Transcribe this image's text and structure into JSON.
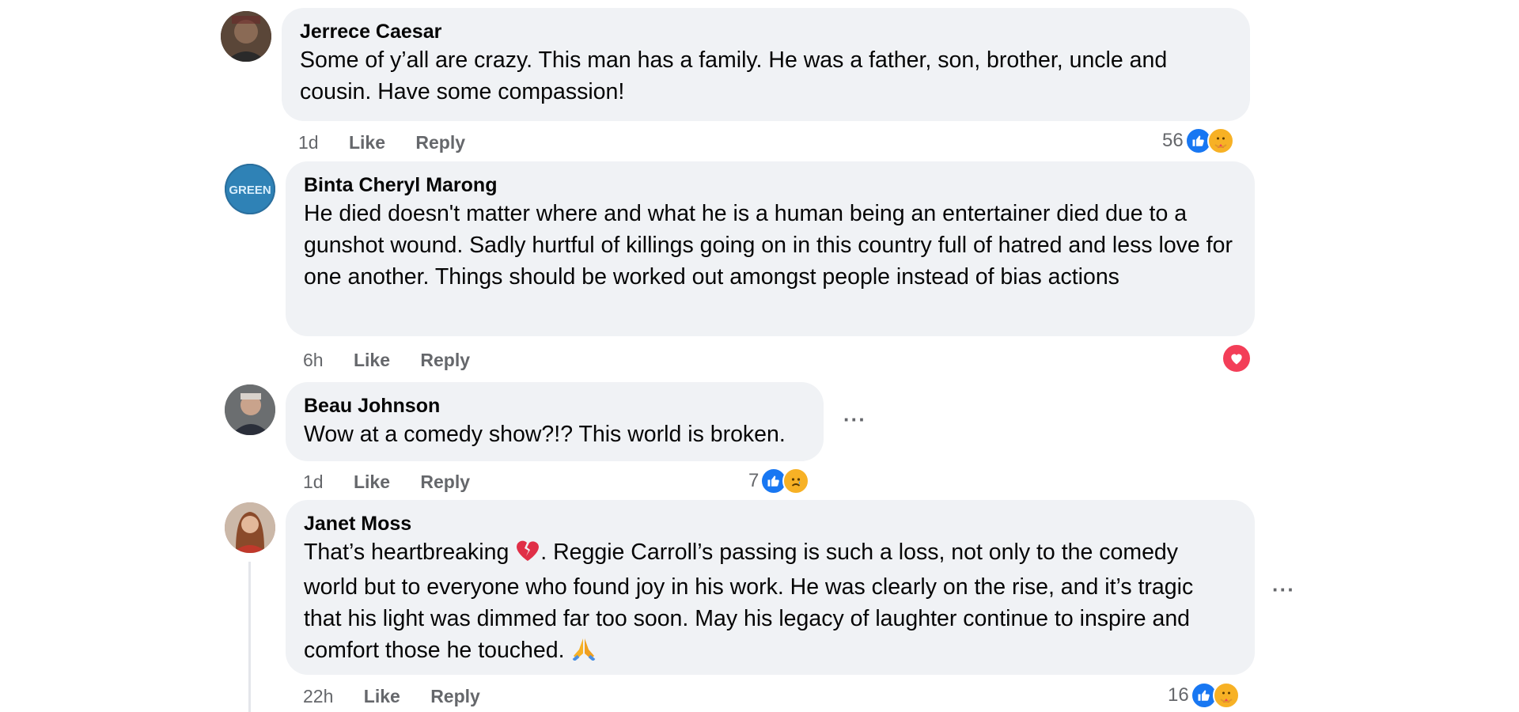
{
  "comments": [
    {
      "author": "Jerrece Caesar",
      "text": "Some of y’all are crazy. This man has a family. He was a father, son, brother, uncle and cousin. Have some compassion!",
      "time": "1d",
      "like_label": "Like",
      "reply_label": "Reply",
      "reaction_count": "56",
      "reactions": [
        "like-icon",
        "care-icon"
      ]
    },
    {
      "author": "Binta Cheryl Marong",
      "avatar_text": "GREEN",
      "text": "He died doesn't matter where and what he is a human being an entertainer died due to a gunshot wound. Sadly hurtful of killings going on in this country full of hatred and less love for one another. Things should be worked out amongst people instead of bias actions",
      "time": "6h",
      "like_label": "Like",
      "reply_label": "Reply",
      "reactions": [
        "love-icon"
      ]
    },
    {
      "author": "Beau Johnson",
      "text": "Wow at a comedy show?!? This world is broken.",
      "time": "1d",
      "like_label": "Like",
      "reply_label": "Reply",
      "reaction_count": "7",
      "reactions": [
        "like-icon",
        "sad-icon"
      ],
      "more_label": "···"
    },
    {
      "author": "Janet Moss",
      "text_part1": "That’s heartbreaking",
      "text_part2": ". Reggie Carroll’s passing is such a loss, not only to the comedy world but to everyone who found joy in his work. He was clearly on the rise, and it’s tragic that his light was dimmed far too soon. May his legacy of laughter continue to inspire and comfort those he touched.",
      "time": "22h",
      "like_label": "Like",
      "reply_label": "Reply",
      "reaction_count": "16",
      "reactions": [
        "like-icon",
        "care-icon"
      ],
      "more_label": "···"
    }
  ],
  "colors": {
    "bubble": "#f0f2f5",
    "meta_text": "#65676b",
    "like_blue": "#1877f2",
    "love_red": "#f33e58",
    "emoji_yellow": "#f7b125"
  }
}
